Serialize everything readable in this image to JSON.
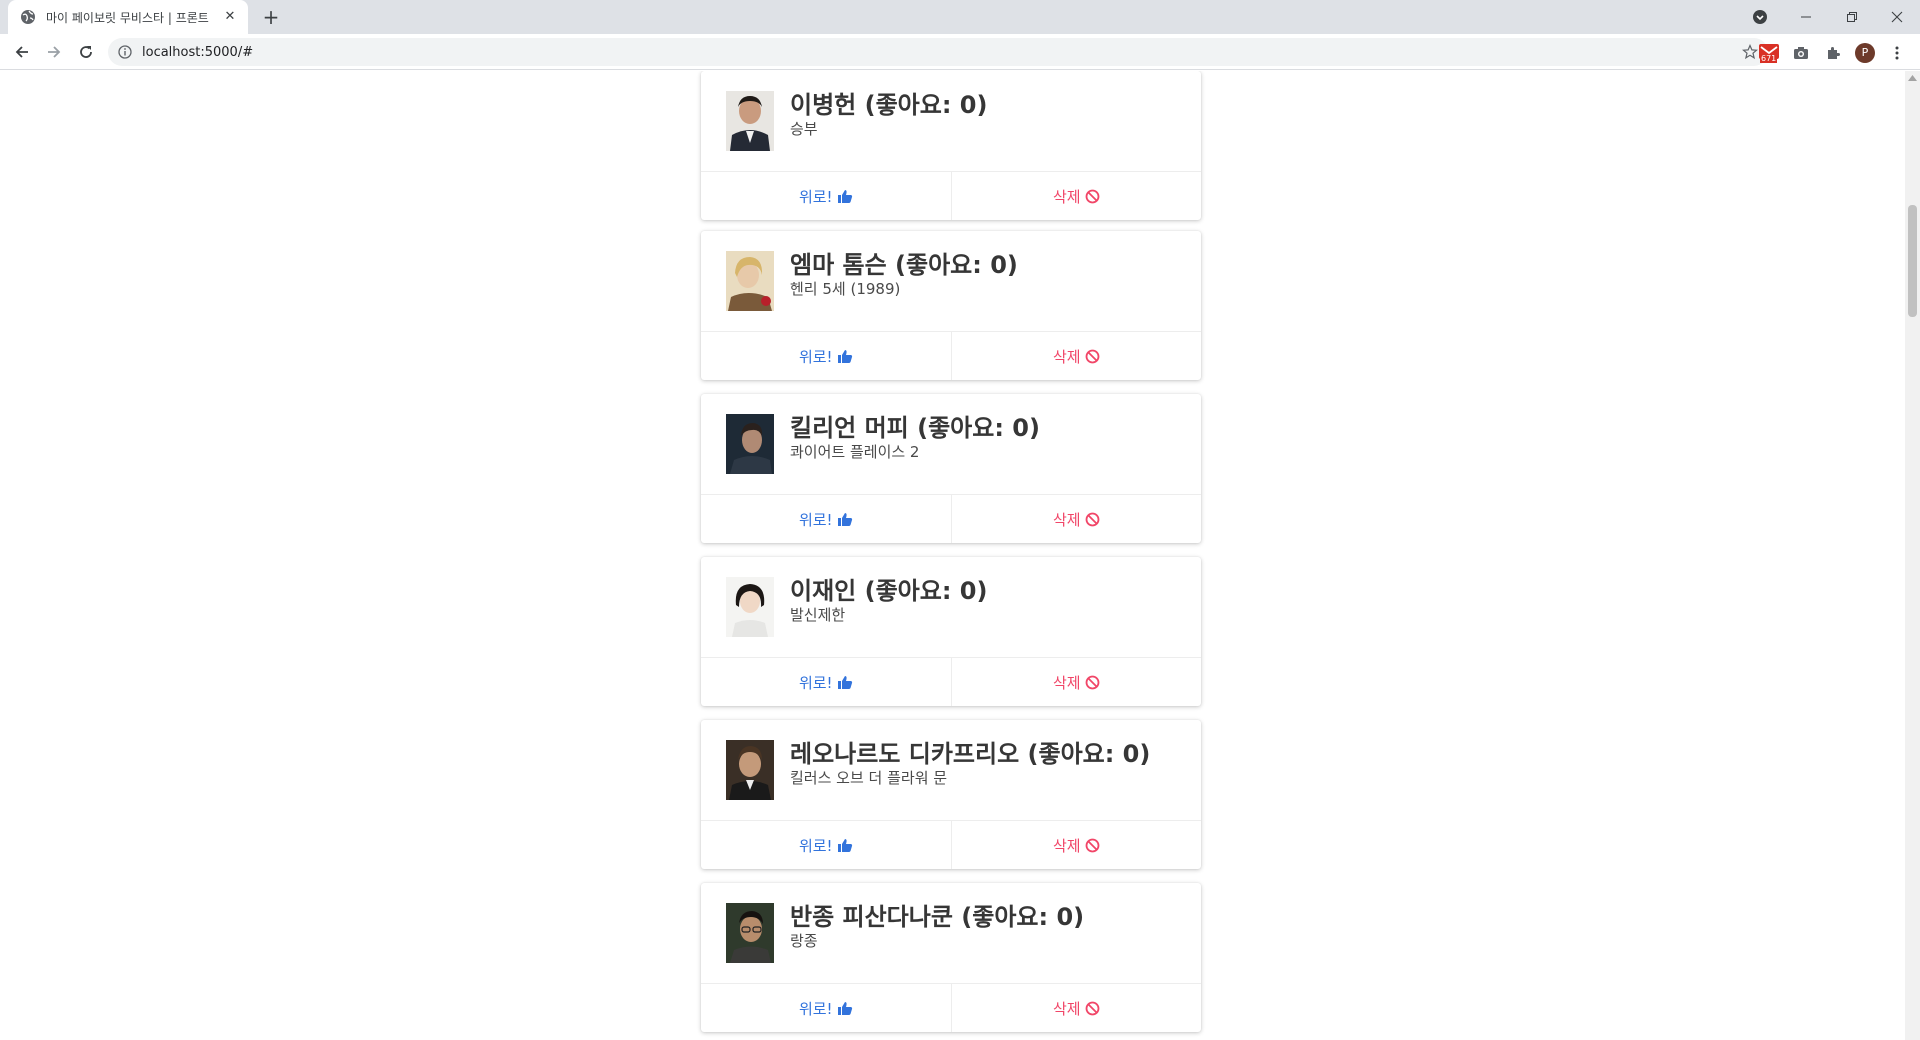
{
  "browser": {
    "tab_title": "마이 페이보릿 무비스타 | 프론트",
    "new_tab_label": "+",
    "address": "localhost:5000/#",
    "ext_badge": "671",
    "profile_initial": "P",
    "colors": {
      "tabstrip": "#dee1e6",
      "ext_red": "#d93025",
      "profile": "#6d3a2a"
    }
  },
  "page": {
    "cards": [
      {
        "name": "이병헌",
        "like_text": "(좋아요: 0)",
        "movie": "승부",
        "like_label": "위로!",
        "delete_label": "삭제"
      },
      {
        "name": "엠마 톰슨",
        "like_text": "(좋아요: 0)",
        "movie": "헨리 5세 (1989)",
        "like_label": "위로!",
        "delete_label": "삭제"
      },
      {
        "name": "킬리언 머피",
        "like_text": "(좋아요: 0)",
        "movie": "콰이어트 플레이스 2",
        "like_label": "위로!",
        "delete_label": "삭제"
      },
      {
        "name": "이재인",
        "like_text": "(좋아요: 0)",
        "movie": "발신제한",
        "like_label": "위로!",
        "delete_label": "삭제"
      },
      {
        "name": "레오나르도 디카프리오",
        "like_text": "(좋아요: 0)",
        "movie": "킬러스 오브 더 플라워 문",
        "like_label": "위로!",
        "delete_label": "삭제"
      },
      {
        "name": "반종 피산다나쿤",
        "like_text": "(좋아요: 0)",
        "movie": "랑종",
        "like_label": "위로!",
        "delete_label": "삭제"
      }
    ],
    "icons": {
      "like": "thumbs-up-icon",
      "delete": "ban-icon"
    },
    "colors": {
      "like": "#3273dc",
      "delete": "#f14668",
      "title": "#363636"
    }
  }
}
